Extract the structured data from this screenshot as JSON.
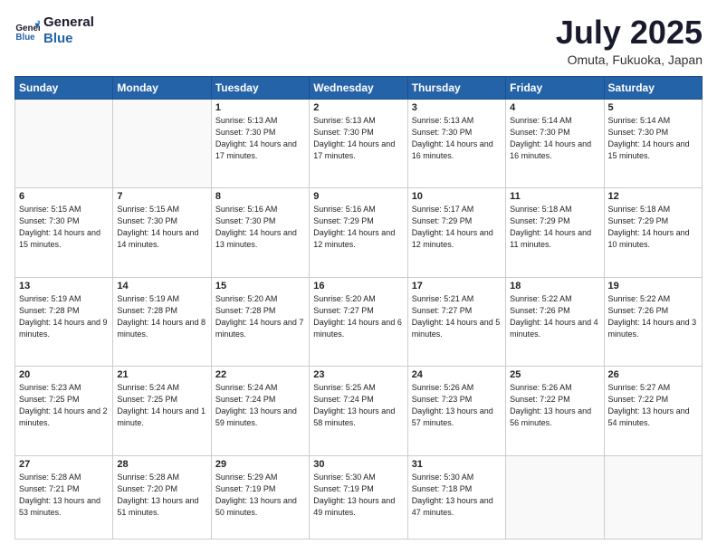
{
  "logo": {
    "line1": "General",
    "line2": "Blue"
  },
  "title": "July 2025",
  "location": "Omuta, Fukuoka, Japan",
  "weekdays": [
    "Sunday",
    "Monday",
    "Tuesday",
    "Wednesday",
    "Thursday",
    "Friday",
    "Saturday"
  ],
  "weeks": [
    [
      {
        "day": "",
        "info": ""
      },
      {
        "day": "",
        "info": ""
      },
      {
        "day": "1",
        "info": "Sunrise: 5:13 AM\nSunset: 7:30 PM\nDaylight: 14 hours and 17 minutes."
      },
      {
        "day": "2",
        "info": "Sunrise: 5:13 AM\nSunset: 7:30 PM\nDaylight: 14 hours and 17 minutes."
      },
      {
        "day": "3",
        "info": "Sunrise: 5:13 AM\nSunset: 7:30 PM\nDaylight: 14 hours and 16 minutes."
      },
      {
        "day": "4",
        "info": "Sunrise: 5:14 AM\nSunset: 7:30 PM\nDaylight: 14 hours and 16 minutes."
      },
      {
        "day": "5",
        "info": "Sunrise: 5:14 AM\nSunset: 7:30 PM\nDaylight: 14 hours and 15 minutes."
      }
    ],
    [
      {
        "day": "6",
        "info": "Sunrise: 5:15 AM\nSunset: 7:30 PM\nDaylight: 14 hours and 15 minutes."
      },
      {
        "day": "7",
        "info": "Sunrise: 5:15 AM\nSunset: 7:30 PM\nDaylight: 14 hours and 14 minutes."
      },
      {
        "day": "8",
        "info": "Sunrise: 5:16 AM\nSunset: 7:30 PM\nDaylight: 14 hours and 13 minutes."
      },
      {
        "day": "9",
        "info": "Sunrise: 5:16 AM\nSunset: 7:29 PM\nDaylight: 14 hours and 12 minutes."
      },
      {
        "day": "10",
        "info": "Sunrise: 5:17 AM\nSunset: 7:29 PM\nDaylight: 14 hours and 12 minutes."
      },
      {
        "day": "11",
        "info": "Sunrise: 5:18 AM\nSunset: 7:29 PM\nDaylight: 14 hours and 11 minutes."
      },
      {
        "day": "12",
        "info": "Sunrise: 5:18 AM\nSunset: 7:29 PM\nDaylight: 14 hours and 10 minutes."
      }
    ],
    [
      {
        "day": "13",
        "info": "Sunrise: 5:19 AM\nSunset: 7:28 PM\nDaylight: 14 hours and 9 minutes."
      },
      {
        "day": "14",
        "info": "Sunrise: 5:19 AM\nSunset: 7:28 PM\nDaylight: 14 hours and 8 minutes."
      },
      {
        "day": "15",
        "info": "Sunrise: 5:20 AM\nSunset: 7:28 PM\nDaylight: 14 hours and 7 minutes."
      },
      {
        "day": "16",
        "info": "Sunrise: 5:20 AM\nSunset: 7:27 PM\nDaylight: 14 hours and 6 minutes."
      },
      {
        "day": "17",
        "info": "Sunrise: 5:21 AM\nSunset: 7:27 PM\nDaylight: 14 hours and 5 minutes."
      },
      {
        "day": "18",
        "info": "Sunrise: 5:22 AM\nSunset: 7:26 PM\nDaylight: 14 hours and 4 minutes."
      },
      {
        "day": "19",
        "info": "Sunrise: 5:22 AM\nSunset: 7:26 PM\nDaylight: 14 hours and 3 minutes."
      }
    ],
    [
      {
        "day": "20",
        "info": "Sunrise: 5:23 AM\nSunset: 7:25 PM\nDaylight: 14 hours and 2 minutes."
      },
      {
        "day": "21",
        "info": "Sunrise: 5:24 AM\nSunset: 7:25 PM\nDaylight: 14 hours and 1 minute."
      },
      {
        "day": "22",
        "info": "Sunrise: 5:24 AM\nSunset: 7:24 PM\nDaylight: 13 hours and 59 minutes."
      },
      {
        "day": "23",
        "info": "Sunrise: 5:25 AM\nSunset: 7:24 PM\nDaylight: 13 hours and 58 minutes."
      },
      {
        "day": "24",
        "info": "Sunrise: 5:26 AM\nSunset: 7:23 PM\nDaylight: 13 hours and 57 minutes."
      },
      {
        "day": "25",
        "info": "Sunrise: 5:26 AM\nSunset: 7:22 PM\nDaylight: 13 hours and 56 minutes."
      },
      {
        "day": "26",
        "info": "Sunrise: 5:27 AM\nSunset: 7:22 PM\nDaylight: 13 hours and 54 minutes."
      }
    ],
    [
      {
        "day": "27",
        "info": "Sunrise: 5:28 AM\nSunset: 7:21 PM\nDaylight: 13 hours and 53 minutes."
      },
      {
        "day": "28",
        "info": "Sunrise: 5:28 AM\nSunset: 7:20 PM\nDaylight: 13 hours and 51 minutes."
      },
      {
        "day": "29",
        "info": "Sunrise: 5:29 AM\nSunset: 7:19 PM\nDaylight: 13 hours and 50 minutes."
      },
      {
        "day": "30",
        "info": "Sunrise: 5:30 AM\nSunset: 7:19 PM\nDaylight: 13 hours and 49 minutes."
      },
      {
        "day": "31",
        "info": "Sunrise: 5:30 AM\nSunset: 7:18 PM\nDaylight: 13 hours and 47 minutes."
      },
      {
        "day": "",
        "info": ""
      },
      {
        "day": "",
        "info": ""
      }
    ]
  ]
}
